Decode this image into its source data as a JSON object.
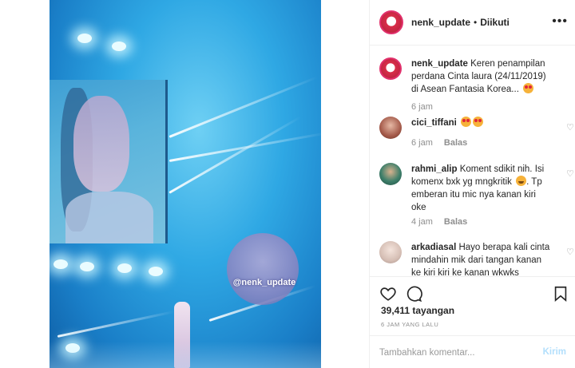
{
  "header": {
    "username": "nenk_update",
    "dot": "•",
    "follow_status": "Diikuti",
    "more_icon": "more-icon"
  },
  "media": {
    "watermark": "@nenk_update"
  },
  "comments": [
    {
      "username": "nenk_update",
      "text": "Keren penampilan perdana Cinta laura (24/11/2019) di Asean Fantasia Korea...",
      "emoji": [
        "heart-eyes"
      ],
      "time": "6 jam",
      "reply": ""
    },
    {
      "username": "cici_tiffani",
      "text": "",
      "emoji": [
        "heart-eyes",
        "heart-eyes"
      ],
      "time": "6 jam",
      "reply": "Balas"
    },
    {
      "username": "rahmi_alip",
      "text": "Koment sdikit nih. Isi komenx bxk yg mngkritik",
      "text2": ". Tp emberan itu mic nya kanan kiri oke",
      "emoji": [
        "grin-sweat"
      ],
      "time": "4 jam",
      "reply": "Balas"
    },
    {
      "username": "arkadiasal",
      "text": "Hayo berapa kali cinta mindahin mik dari tangan kanan ke kiri kiri ke kanan wkwks",
      "emoji": [],
      "time": "",
      "reply": ""
    }
  ],
  "actions": {
    "like_icon": "heart-icon",
    "comment_icon": "comment-icon",
    "save_icon": "bookmark-icon"
  },
  "views": "39,411 tayangan",
  "posted_ago": "6 JAM YANG LALU",
  "composer": {
    "placeholder": "Tambahkan komentar...",
    "post_label": "Kirim"
  },
  "colors": {
    "accent_link": "#b2dffc",
    "muted": "#8e8e8e",
    "text": "#262626",
    "stage_blue": "#2fa8e4"
  }
}
